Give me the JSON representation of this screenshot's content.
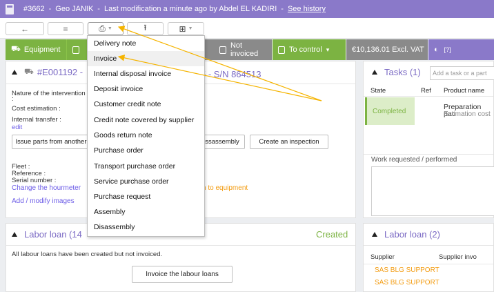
{
  "header": {
    "ref": "#3662",
    "name": "Geo JANIK",
    "modified": "Last modification a minute ago by Abdel EL KADIRI",
    "history_link": "See history"
  },
  "toolbar": {
    "back_glyph": "←",
    "list_glyph": "≡",
    "print_glyph": "⎙",
    "upload_glyph": "⭱",
    "split_glyph": "⊞"
  },
  "status": {
    "equipment": "Equipment",
    "not_invoiced": "Not invoiced",
    "to_control": "To control",
    "control_caret": "▾",
    "amount": "€10,136.01 Excl. VAT",
    "purple_label": "[?]"
  },
  "equipment": {
    "title_left": "#E001192 -",
    "title_right": "5 - S/N 864513",
    "nature_label": "Nature of the intervention :",
    "cost_label": "Cost estimation :",
    "transfer_label": "Internal transfer :",
    "edit_link": "edit",
    "issue_parts_button": "Issue parts from another",
    "disassembly_button": "ssassembly",
    "inspection_button": "Create an inspection",
    "fleet_label": "Fleet :",
    "reference_label": "Reference :",
    "serial_label": "Serial number :",
    "change_hourmeter": "Change the hourmeter",
    "to_equipment": "n to equipment",
    "add_images": "Add / modify images"
  },
  "tasks": {
    "title": "Tasks (1)",
    "input_placeholder": "Add a task or a part",
    "col_state": "State",
    "col_ref": "Ref",
    "col_product": "Product name",
    "state_value": "Completed",
    "product_name": "Preparation pac",
    "product_sub": "Estimation cost",
    "work_label": "Work requested / performed"
  },
  "labor": {
    "title": "Labor loan (14",
    "status": "Created",
    "message": "All labour loans have been created but not invoiced.",
    "invoice_button": "Invoice the labour loans"
  },
  "labor2": {
    "title": "Labor loan (2)",
    "col_supplier": "Supplier",
    "col_invoice": "Supplier invo",
    "rows": [
      "SAS BLG SUPPORT",
      "SAS BLG SUPPORT"
    ]
  },
  "menu": {
    "items": [
      "Delivery note",
      "Invoice",
      "Internal disposal invoice",
      "Deposit invoice",
      "Customer credit note",
      "Credit note covered by supplier",
      "Goods return note",
      "Purchase order",
      "Transport purchase order",
      "Service purchase order",
      "Purchase request",
      "Assembly",
      "Disassembly"
    ]
  },
  "colors": {
    "header": "#8a79c9",
    "green": "#7cb342",
    "grey": "#8a8a8a",
    "arrow": "#f5b400",
    "orange_text": "#f39c12"
  }
}
